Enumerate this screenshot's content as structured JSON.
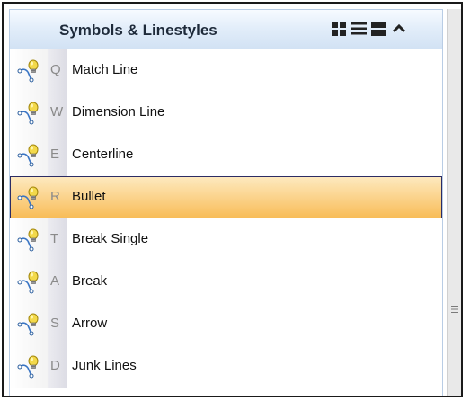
{
  "panel": {
    "title": "Symbols & Linestyles",
    "header_buttons": [
      {
        "name": "grid-view-icon",
        "semantic": "tile-view"
      },
      {
        "name": "list-view-icon",
        "semantic": "list-view"
      },
      {
        "name": "details-view-icon",
        "semantic": "large-view"
      },
      {
        "name": "collapse-chevron-icon",
        "semantic": "collapse-panel"
      }
    ]
  },
  "items": [
    {
      "key": "Q",
      "label": "Match Line",
      "selected": false,
      "icon": "lightbulb-pin-icon"
    },
    {
      "key": "W",
      "label": "Dimension Line",
      "selected": false,
      "icon": "lightbulb-pin-icon"
    },
    {
      "key": "E",
      "label": "Centerline",
      "selected": false,
      "icon": "lightbulb-pin-icon"
    },
    {
      "key": "R",
      "label": "Bullet",
      "selected": true,
      "icon": "lightbulb-pin-icon"
    },
    {
      "key": "T",
      "label": "Break Single",
      "selected": false,
      "icon": "lightbulb-pin-icon"
    },
    {
      "key": "A",
      "label": "Break",
      "selected": false,
      "icon": "lightbulb-pin-icon"
    },
    {
      "key": "S",
      "label": "Arrow",
      "selected": false,
      "icon": "lightbulb-pin-icon"
    },
    {
      "key": "D",
      "label": "Junk Lines",
      "selected": false,
      "icon": "lightbulb-pin-icon"
    }
  ],
  "colors": {
    "selection_fill": "#f8bd58",
    "selection_border": "#2c2c64",
    "header_gradient_end": "#d2e2f4"
  }
}
